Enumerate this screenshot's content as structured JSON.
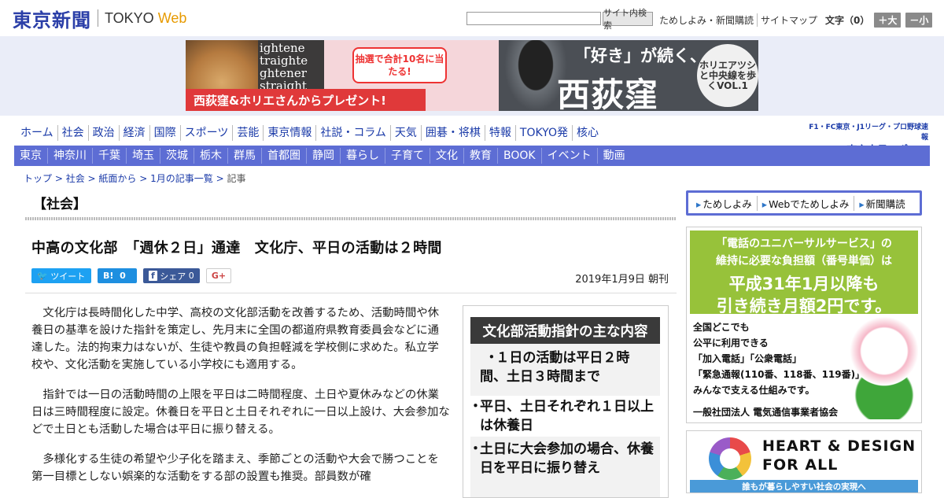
{
  "header": {
    "logo_jp": "東京新聞",
    "logo_en": "TOKYO",
    "logo_web": "Web",
    "search_placeholder": "",
    "search_button": "サイト内検索",
    "links": [
      "ためしよみ・新聞購読",
      "サイトマップ"
    ],
    "font_label": "文字（0）",
    "font_plus": "＋大",
    "font_minus": "－小"
  },
  "banner": {
    "left_text": "ightene\ntraighte\nghtener\nstraight",
    "popup": "抽選で合計10名に当たる!",
    "strip": "西荻窪&ホリエさんからプレゼント!",
    "headline_small": "「好き」が続く、",
    "headline_big": "西荻窪",
    "circle": "ホリエアツシと中央線を歩くVOL.1"
  },
  "nav": {
    "main": [
      "ホーム",
      "社会",
      "政治",
      "経済",
      "国際",
      "スポーツ",
      "芸能",
      "東京情報",
      "社説・コラム",
      "天気",
      "囲碁・将棋",
      "特報",
      "TOKYO発",
      "核心"
    ],
    "chunichi_small": "F1・FC東京・J1リーグ・プロ野球速報",
    "chunichi_big": "東京中日スポーツ",
    "regions": [
      "東京",
      "神奈川",
      "千葉",
      "埼玉",
      "茨城",
      "栃木",
      "群馬",
      "首都圏",
      "静岡",
      "暮らし",
      "子育て",
      "文化",
      "教育",
      "BOOK",
      "イベント",
      "動画"
    ]
  },
  "breadcrumb": {
    "items": [
      "トップ",
      "社会",
      "紙面から",
      "1月の記事一覧"
    ],
    "current": "記事",
    "separator": " > "
  },
  "article": {
    "section": "【社会】",
    "title": "中高の文化部　「週休２日」通達　文化庁、平日の活動は２時間",
    "share": {
      "tweet": "ツイート",
      "hatena_count": "0",
      "fb_label": "シェア",
      "fb_count": "0",
      "gplus": "G+"
    },
    "date": "2019年1月9日 朝刊",
    "paragraphs": [
      "文化庁は長時間化した中学、高校の文化部活動を改善するため、活動時間や休養日の基準を設けた指針を策定し、先月末に全国の都道府県教育委員会などに通達した。法的拘束力はないが、生徒や教員の負担軽減を学校側に求めた。私立学校や、文化活動を実施している小学校にも適用する。",
      "指針では一日の活動時間の上限を平日は二時間程度、土日や夏休みなどの休業日は三時間程度に設定。休養日を平日と土日それぞれに一日以上設け、大会参加などで土日とも活動した場合は平日に振り替える。",
      "多様化する生徒の希望や少子化を踏まえ、季節ごとの活動や大会で勝つことを第一目標としない娯楽的な活動をする部の設置も推奨。部員数が確"
    ],
    "figure": {
      "heading": "文化部活動指針の主な内容",
      "items": [
        "１日の活動は平日２時間、土日３時間まで",
        "平日、土日それぞれ１日以上は休養日",
        "土日に大会参加の場合、休養日を平日に振り替え"
      ]
    }
  },
  "right": {
    "links": [
      "ためしよみ",
      "Webでためしよみ",
      "新聞購読"
    ],
    "universal_ad": {
      "line1": "「電話のユニバーサルサービス」の",
      "line2": "維持に必要な負担額（番号単価）は",
      "line3": "平成31年1月以降も",
      "line4": "引き続き月額2円です。",
      "body": [
        "全国どこでも",
        "公平に利用できる",
        "「加入電話」「公衆電話」",
        "「緊急通報(110番、118番、119番)」を",
        "みんなで支える仕組みです。"
      ],
      "footer": "一般社団法人 電気通信事業者協会"
    },
    "heart_ad": {
      "line1": "HEART & DESIGN",
      "line2": "FOR ALL",
      "bar": "誰もが暮らしやすい社会の実現へ"
    }
  }
}
